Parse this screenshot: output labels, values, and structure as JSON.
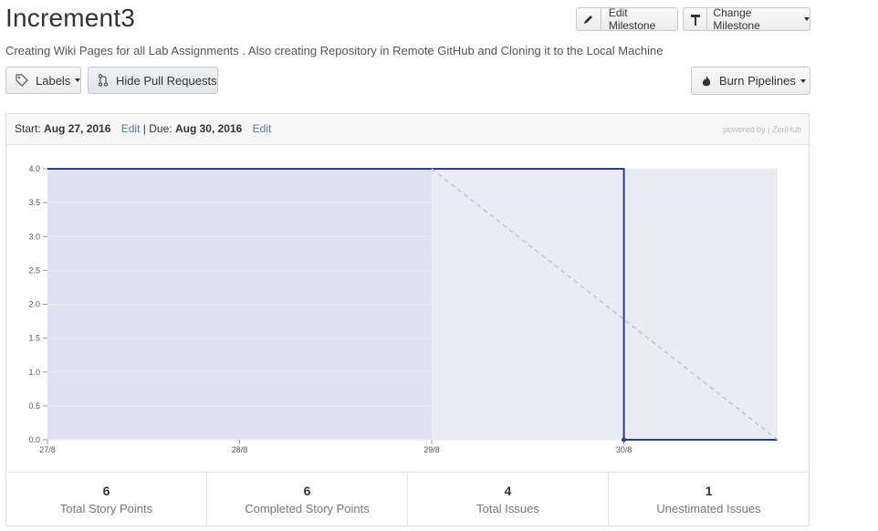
{
  "milestone": {
    "title": "Increment3",
    "description": "Creating Wiki Pages for all Lab Assignments . Also creating Repository in Remote GitHub and Cloning it to the Local Machine"
  },
  "toolbar": {
    "edit_milestone": "Edit Milestone",
    "change_milestone": "Change Milestone",
    "labels": "Labels",
    "hide_pull_requests": "Hide Pull Requests",
    "burn_pipelines": "Burn Pipelines"
  },
  "dates": {
    "start_label": "Start:",
    "start_date": "Aug 27, 2016",
    "edit": "Edit",
    "divider": "|",
    "due_label": "Due:",
    "due_date": "Aug 30, 2016",
    "powered_by": "powered by | ZenHub"
  },
  "chart_data": {
    "type": "line",
    "x_ticks": [
      "27/8",
      "28/8",
      "29/8",
      "30/8"
    ],
    "y_ticks": [
      "0.0",
      "0.5",
      "1.0",
      "1.5",
      "2.0",
      "2.5",
      "3.0",
      "3.5",
      "4.0"
    ],
    "ylim": [
      0,
      4
    ],
    "x_index_range": [
      0,
      3.8
    ],
    "series": [
      {
        "kind": "remaining",
        "x": [
          0,
          3,
          3,
          3.8
        ],
        "y": [
          4,
          4,
          0,
          0
        ]
      },
      {
        "kind": "ideal",
        "x": [
          2,
          3.8
        ],
        "y": [
          4,
          0
        ]
      }
    ],
    "shaded_regions": [
      {
        "x": [
          0,
          2
        ],
        "y": [
          0,
          4
        ],
        "color": "#e0e1f0"
      },
      {
        "x": [
          2,
          3.8
        ],
        "y": [
          0,
          4
        ],
        "color": "#ebebf5"
      }
    ],
    "colors": {
      "remaining": "#2e3d86",
      "ideal": "#c4c4d0",
      "grid": "#ececec"
    }
  },
  "stats": [
    {
      "value": "6",
      "label": "Total Story Points"
    },
    {
      "value": "6",
      "label": "Completed Story Points"
    },
    {
      "value": "4",
      "label": "Total Issues"
    },
    {
      "value": "1",
      "label": "Unestimated Issues"
    }
  ]
}
